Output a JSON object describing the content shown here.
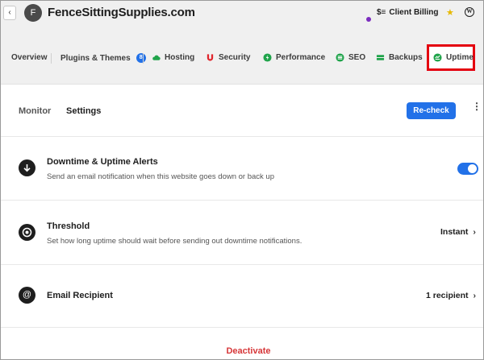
{
  "header": {
    "back_icon": "chevron-left-icon",
    "avatar_letter": "F",
    "site_title": "FenceSittingSupplies.com",
    "billing_icon": "$≡",
    "billing_label": "Client Billing",
    "star_icon": "★",
    "wp_icon": "W"
  },
  "nav": {
    "tabs": [
      {
        "label": "Overview",
        "icon": ""
      },
      {
        "label": "Plugins & Themes",
        "icon": "",
        "badge": "8"
      },
      {
        "label": "Hosting",
        "icon": "cloud-icon"
      },
      {
        "label": "Security",
        "icon": "shield-icon"
      },
      {
        "label": "Performance",
        "icon": "bolt-icon"
      },
      {
        "label": "SEO",
        "icon": "seo-icon"
      },
      {
        "label": "Backups",
        "icon": "backup-icon"
      },
      {
        "label": "Uptime",
        "icon": "uptime-icon"
      }
    ],
    "accent": "#2271e8",
    "highlight_color": "#e4000f"
  },
  "subheader": {
    "monitor_label": "Monitor",
    "settings_label": "Settings",
    "recheck_label": "Re-check",
    "more_icon": "⋮"
  },
  "rows": {
    "alerts": {
      "title": "Downtime & Uptime Alerts",
      "desc": "Send an email notification when this website goes down or back up",
      "toggle_on": true
    },
    "threshold": {
      "title": "Threshold",
      "desc": "Set how long uptime should wait before sending out downtime notifications.",
      "value": "Instant"
    },
    "email": {
      "title": "Email Recipient",
      "value": "1 recipient"
    }
  },
  "footer": {
    "deactivate_label": "Deactivate"
  }
}
